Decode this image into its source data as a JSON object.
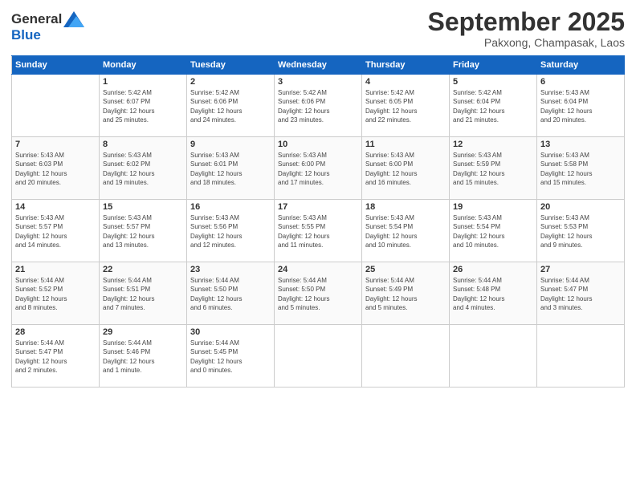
{
  "header": {
    "logo_line1": "General",
    "logo_line2": "Blue",
    "month": "September 2025",
    "location": "Pakxong, Champasak, Laos"
  },
  "days_of_week": [
    "Sunday",
    "Monday",
    "Tuesday",
    "Wednesday",
    "Thursday",
    "Friday",
    "Saturday"
  ],
  "weeks": [
    [
      {
        "num": "",
        "info": ""
      },
      {
        "num": "1",
        "info": "Sunrise: 5:42 AM\nSunset: 6:07 PM\nDaylight: 12 hours\nand 25 minutes."
      },
      {
        "num": "2",
        "info": "Sunrise: 5:42 AM\nSunset: 6:06 PM\nDaylight: 12 hours\nand 24 minutes."
      },
      {
        "num": "3",
        "info": "Sunrise: 5:42 AM\nSunset: 6:06 PM\nDaylight: 12 hours\nand 23 minutes."
      },
      {
        "num": "4",
        "info": "Sunrise: 5:42 AM\nSunset: 6:05 PM\nDaylight: 12 hours\nand 22 minutes."
      },
      {
        "num": "5",
        "info": "Sunrise: 5:42 AM\nSunset: 6:04 PM\nDaylight: 12 hours\nand 21 minutes."
      },
      {
        "num": "6",
        "info": "Sunrise: 5:43 AM\nSunset: 6:04 PM\nDaylight: 12 hours\nand 20 minutes."
      }
    ],
    [
      {
        "num": "7",
        "info": "Sunrise: 5:43 AM\nSunset: 6:03 PM\nDaylight: 12 hours\nand 20 minutes."
      },
      {
        "num": "8",
        "info": "Sunrise: 5:43 AM\nSunset: 6:02 PM\nDaylight: 12 hours\nand 19 minutes."
      },
      {
        "num": "9",
        "info": "Sunrise: 5:43 AM\nSunset: 6:01 PM\nDaylight: 12 hours\nand 18 minutes."
      },
      {
        "num": "10",
        "info": "Sunrise: 5:43 AM\nSunset: 6:00 PM\nDaylight: 12 hours\nand 17 minutes."
      },
      {
        "num": "11",
        "info": "Sunrise: 5:43 AM\nSunset: 6:00 PM\nDaylight: 12 hours\nand 16 minutes."
      },
      {
        "num": "12",
        "info": "Sunrise: 5:43 AM\nSunset: 5:59 PM\nDaylight: 12 hours\nand 15 minutes."
      },
      {
        "num": "13",
        "info": "Sunrise: 5:43 AM\nSunset: 5:58 PM\nDaylight: 12 hours\nand 15 minutes."
      }
    ],
    [
      {
        "num": "14",
        "info": "Sunrise: 5:43 AM\nSunset: 5:57 PM\nDaylight: 12 hours\nand 14 minutes."
      },
      {
        "num": "15",
        "info": "Sunrise: 5:43 AM\nSunset: 5:57 PM\nDaylight: 12 hours\nand 13 minutes."
      },
      {
        "num": "16",
        "info": "Sunrise: 5:43 AM\nSunset: 5:56 PM\nDaylight: 12 hours\nand 12 minutes."
      },
      {
        "num": "17",
        "info": "Sunrise: 5:43 AM\nSunset: 5:55 PM\nDaylight: 12 hours\nand 11 minutes."
      },
      {
        "num": "18",
        "info": "Sunrise: 5:43 AM\nSunset: 5:54 PM\nDaylight: 12 hours\nand 10 minutes."
      },
      {
        "num": "19",
        "info": "Sunrise: 5:43 AM\nSunset: 5:54 PM\nDaylight: 12 hours\nand 10 minutes."
      },
      {
        "num": "20",
        "info": "Sunrise: 5:43 AM\nSunset: 5:53 PM\nDaylight: 12 hours\nand 9 minutes."
      }
    ],
    [
      {
        "num": "21",
        "info": "Sunrise: 5:44 AM\nSunset: 5:52 PM\nDaylight: 12 hours\nand 8 minutes."
      },
      {
        "num": "22",
        "info": "Sunrise: 5:44 AM\nSunset: 5:51 PM\nDaylight: 12 hours\nand 7 minutes."
      },
      {
        "num": "23",
        "info": "Sunrise: 5:44 AM\nSunset: 5:50 PM\nDaylight: 12 hours\nand 6 minutes."
      },
      {
        "num": "24",
        "info": "Sunrise: 5:44 AM\nSunset: 5:50 PM\nDaylight: 12 hours\nand 5 minutes."
      },
      {
        "num": "25",
        "info": "Sunrise: 5:44 AM\nSunset: 5:49 PM\nDaylight: 12 hours\nand 5 minutes."
      },
      {
        "num": "26",
        "info": "Sunrise: 5:44 AM\nSunset: 5:48 PM\nDaylight: 12 hours\nand 4 minutes."
      },
      {
        "num": "27",
        "info": "Sunrise: 5:44 AM\nSunset: 5:47 PM\nDaylight: 12 hours\nand 3 minutes."
      }
    ],
    [
      {
        "num": "28",
        "info": "Sunrise: 5:44 AM\nSunset: 5:47 PM\nDaylight: 12 hours\nand 2 minutes."
      },
      {
        "num": "29",
        "info": "Sunrise: 5:44 AM\nSunset: 5:46 PM\nDaylight: 12 hours\nand 1 minute."
      },
      {
        "num": "30",
        "info": "Sunrise: 5:44 AM\nSunset: 5:45 PM\nDaylight: 12 hours\nand 0 minutes."
      },
      {
        "num": "",
        "info": ""
      },
      {
        "num": "",
        "info": ""
      },
      {
        "num": "",
        "info": ""
      },
      {
        "num": "",
        "info": ""
      }
    ]
  ]
}
